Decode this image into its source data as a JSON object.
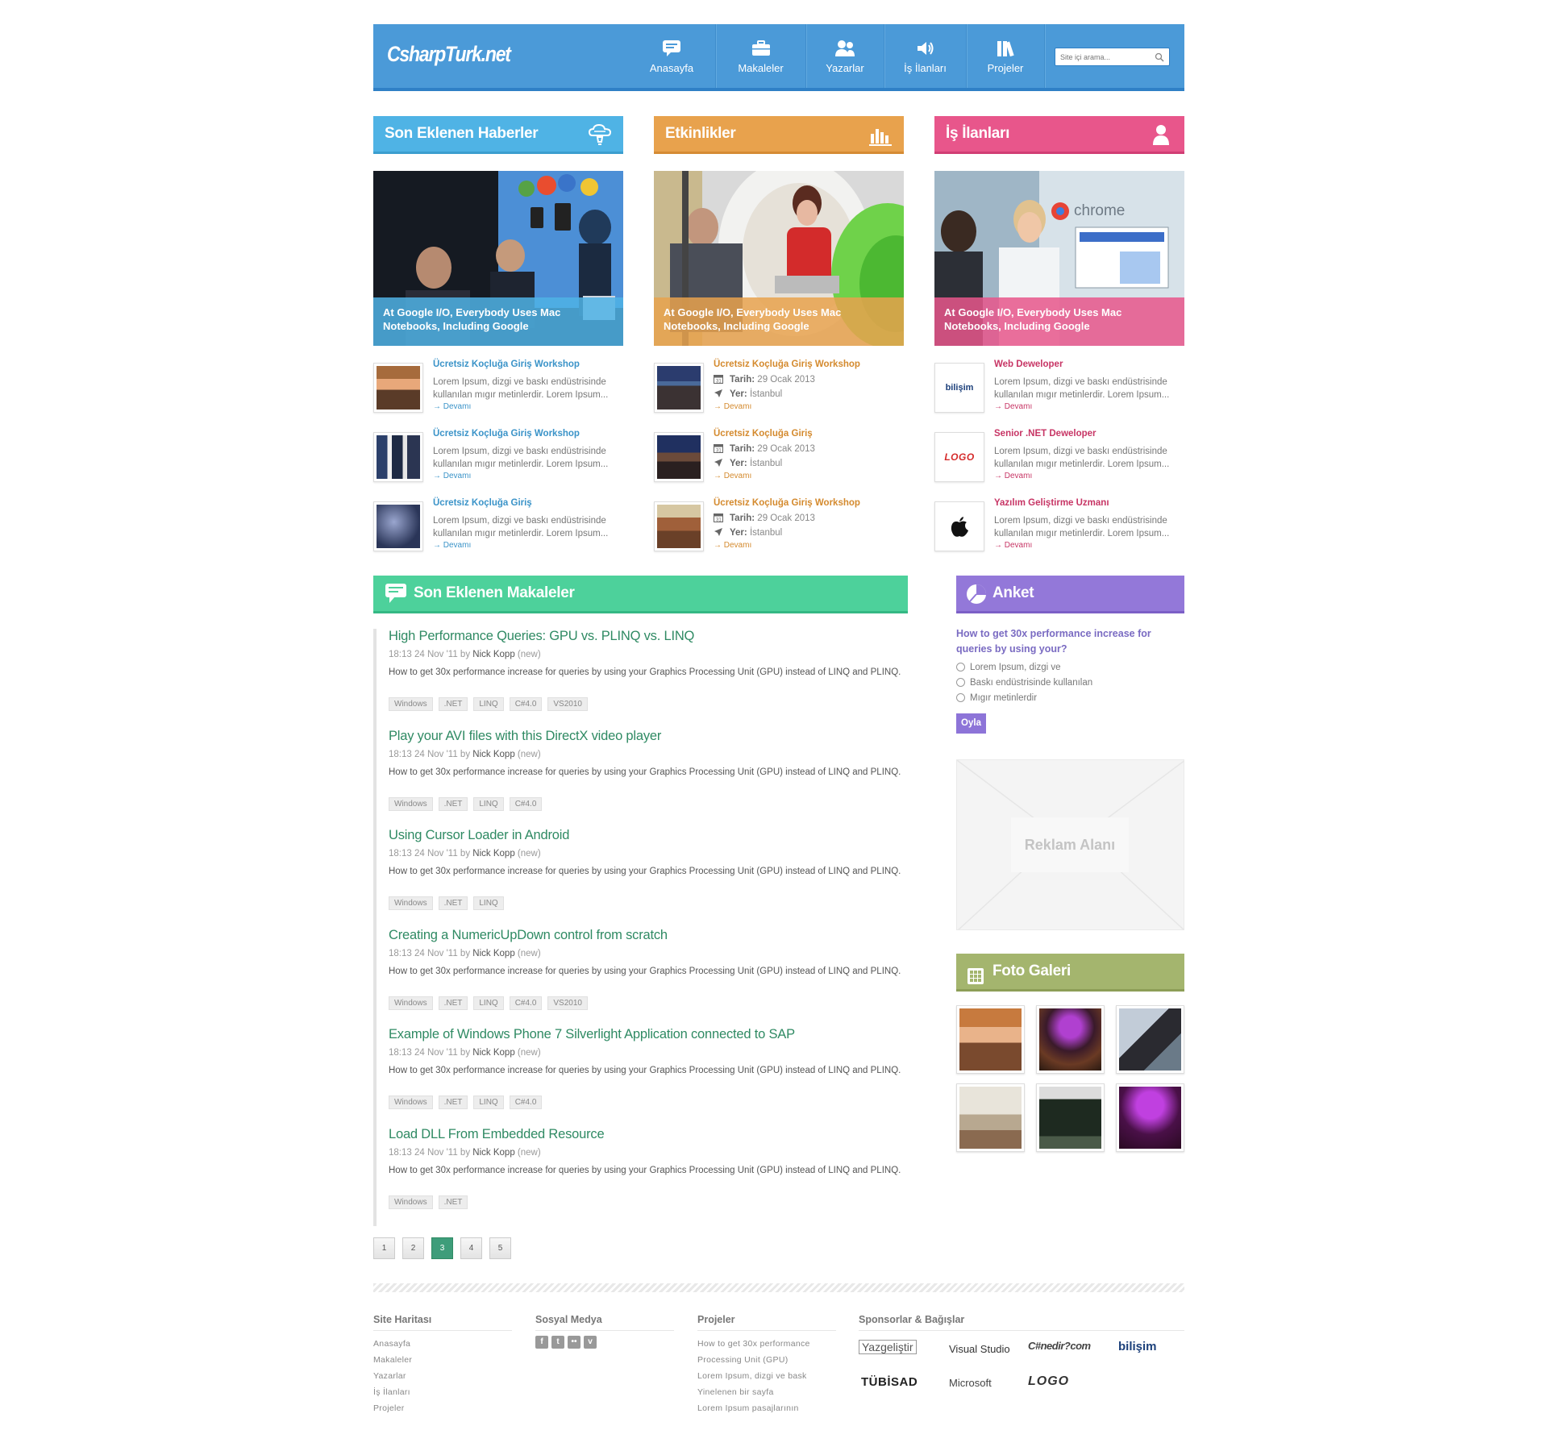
{
  "header": {
    "logo": "CsharpTurk.net",
    "nav": [
      {
        "label": "Anasayfa",
        "icon": "chat-bubble-icon"
      },
      {
        "label": "Makaleler",
        "icon": "briefcase-icon"
      },
      {
        "label": "Yazarlar",
        "icon": "users-icon"
      },
      {
        "label": "İş İlanları",
        "icon": "megaphone-icon"
      },
      {
        "label": "Projeler",
        "icon": "books-icon"
      }
    ],
    "search_placeholder": "Site içi arama..."
  },
  "news": {
    "title": "Son Eklenen Haberler",
    "color": "#4fb3e5",
    "hero_caption": "At Google I/O, Everybody Uses Mac Notebooks, Including Google",
    "items": [
      {
        "title": "Ücretsiz Koçluğa Giriş Workshop",
        "desc": "Lorem Ipsum, dizgi ve baskı endüstrisinde kullanılan mıgır metinlerdir. Lorem Ipsum...",
        "more": "→ Devamı"
      },
      {
        "title": "Ücretsiz Koçluğa Giriş Workshop",
        "desc": "Lorem Ipsum, dizgi ve baskı endüstrisinde kullanılan mıgır metinlerdir. Lorem Ipsum...",
        "more": "→ Devamı"
      },
      {
        "title": "Ücretsiz Koçluğa Giriş",
        "desc": "Lorem Ipsum, dizgi ve baskı endüstrisinde kullanılan mıgır metinlerdir. Lorem Ipsum...",
        "more": "→ Devamı"
      }
    ]
  },
  "events": {
    "title": "Etkinlikler",
    "color": "#e8a24d",
    "hero_caption": "At Google I/O, Everybody Uses Mac Notebooks, Including Google",
    "date_label": "Tarih:",
    "place_label": "Yer:",
    "items": [
      {
        "title": "Ücretsiz Koçluğa Giriş Workshop",
        "date": "29 Ocak 2013",
        "place": "İstanbul",
        "more": "→ Devamı"
      },
      {
        "title": "Ücretsiz Koçluğa Giriş",
        "date": "29 Ocak 2013",
        "place": "İstanbul",
        "more": "→ Devamı"
      },
      {
        "title": "Ücretsiz Koçluğa Giriş Workshop",
        "date": "29 Ocak 2013",
        "place": "İstanbul",
        "more": "→ Devamı"
      }
    ]
  },
  "jobs": {
    "title": "İş İlanları",
    "color": "#e8568b",
    "hero_caption": "At Google I/O, Everybody Uses Mac Notebooks, Including Google",
    "hero_brand": "chrome",
    "items": [
      {
        "title": "Web Deweloper",
        "logo": "bilişim",
        "desc": "Lorem Ipsum, dizgi ve baskı endüstrisinde kullanılan mıgır metinlerdir. Lorem Ipsum...",
        "more": "→ Devamı"
      },
      {
        "title": "Senior .NET Deweloper",
        "logo": "LOGO",
        "desc": "Lorem Ipsum, dizgi ve baskı endüstrisinde kullanılan mıgır metinlerdir. Lorem Ipsum...",
        "more": "→ Devamı"
      },
      {
        "title": "Yazılım Geliştirme Uzmanı",
        "logo": "apple",
        "desc": "Lorem Ipsum, dizgi ve baskı endüstrisinde kullanılan mıgır metinlerdir. Lorem Ipsum...",
        "more": "→ Devamı"
      }
    ]
  },
  "articles": {
    "title": "Son Eklenen Makaleler",
    "color": "#4dd19b",
    "items": [
      {
        "title": "High Performance Queries: GPU vs. PLINQ vs. LINQ",
        "time": "18:13 24 Nov '11 by",
        "author": "Nick Kopp",
        "status": "(new)",
        "desc": "How to get 30x performance increase for queries by using your Graphics Processing Unit (GPU) instead of LINQ and PLINQ.",
        "tags": [
          "Windows",
          ".NET",
          "LINQ",
          "C#4.0",
          "VS2010"
        ]
      },
      {
        "title": "Play your AVI files with this DirectX video player",
        "time": "18:13 24 Nov '11 by",
        "author": "Nick Kopp",
        "status": "(new)",
        "desc": "How to get 30x performance increase for queries by using your Graphics Processing Unit (GPU) instead of LINQ and PLINQ.",
        "tags": [
          "Windows",
          ".NET",
          "LINQ",
          "C#4.0"
        ]
      },
      {
        "title": "Using Cursor Loader in Android",
        "time": "18:13 24 Nov '11 by",
        "author": "Nick Kopp",
        "status": "(new)",
        "desc": "How to get 30x performance increase for queries by using your Graphics Processing Unit (GPU) instead of LINQ and PLINQ.",
        "tags": [
          "Windows",
          ".NET",
          "LINQ"
        ]
      },
      {
        "title": "Creating a NumericUpDown control from scratch",
        "time": "18:13 24 Nov '11 by",
        "author": "Nick Kopp",
        "status": "(new)",
        "desc": "How to get 30x performance increase for queries by using your Graphics Processing Unit (GPU) instead of LINQ and PLINQ.",
        "tags": [
          "Windows",
          ".NET",
          "LINQ",
          "C#4.0",
          "VS2010"
        ]
      },
      {
        "title": "Example of Windows Phone 7 Silverlight Application connected to SAP",
        "time": "18:13 24 Nov '11 by",
        "author": "Nick Kopp",
        "status": "(new)",
        "desc": "How to get 30x performance increase for queries by using your Graphics Processing Unit (GPU) instead of LINQ and PLINQ.",
        "tags": [
          "Windows",
          ".NET",
          "LINQ",
          "C#4.0"
        ]
      },
      {
        "title": "Load DLL From Embedded Resource",
        "time": "18:13 24 Nov '11 by",
        "author": "Nick Kopp",
        "status": "(new)",
        "desc": "How to get 30x performance increase for queries by using your Graphics Processing Unit (GPU) instead of LINQ and PLINQ.",
        "tags": [
          "Windows",
          ".NET"
        ]
      }
    ],
    "pages": [
      "1",
      "2",
      "3",
      "4",
      "5"
    ],
    "current_page": "3"
  },
  "poll": {
    "title": "Anket",
    "color": "#9378d9",
    "question": "How to get 30x performance increase for queries by using your?",
    "options": [
      "Lorem Ipsum, dizgi ve",
      "Baskı endüstrisinde kullanılan",
      "Mıgır metinlerdir"
    ],
    "vote_label": "Oyla"
  },
  "ad": {
    "label": "Reklam Alanı"
  },
  "gallery": {
    "title": "Foto Galeri",
    "color": "#a4b56e"
  },
  "footer": {
    "sitemap": {
      "title": "Site Haritası",
      "links": [
        "Anasayfa",
        "Makaleler",
        "Yazarlar",
        "İş İlanları",
        "Projeler"
      ]
    },
    "social": {
      "title": "Sosyal Medya"
    },
    "projects": {
      "title": "Projeler",
      "links": [
        "How to get 30x performance",
        "Processing Unit (GPU)",
        "Lorem Ipsum, dizgi ve bask",
        "Yinelenen bir sayfa",
        "Lorem Ipsum pasajlarının"
      ]
    },
    "sponsors": {
      "title": "Sponsorlar & Bağışlar",
      "names": [
        "Yazgeliştir",
        "Visual Studio",
        "C#nedir?com",
        "bilişim",
        "TÜBİSAD",
        "Microsoft",
        "LOGO"
      ]
    }
  }
}
